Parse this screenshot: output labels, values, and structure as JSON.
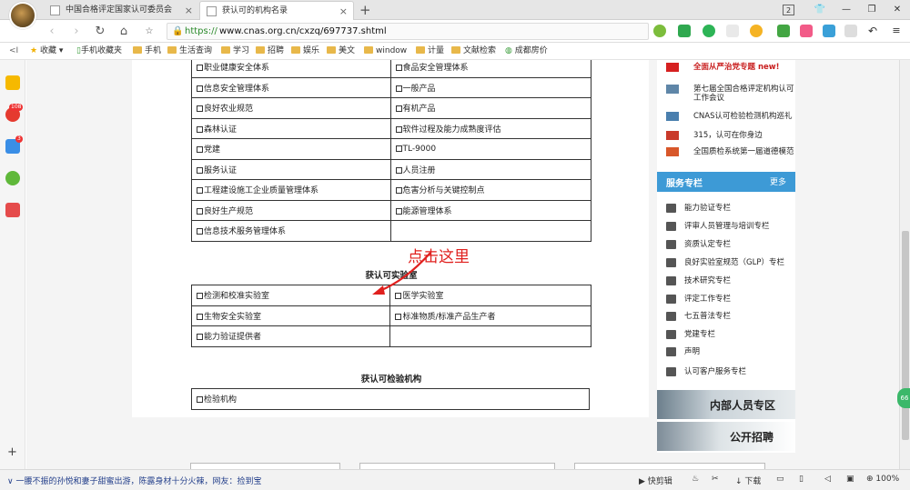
{
  "browser": {
    "tabs": [
      {
        "label": "中国合格评定国家认可委员会"
      },
      {
        "label": "获认可的机构名录"
      }
    ],
    "tab_count": "2",
    "url_protocol": "https://",
    "url_host": "www.cnas.org.cn/cxzq/697737.shtml",
    "bookmarks": [
      {
        "label": "收藏",
        "icon": "star-icon"
      },
      {
        "label": "手机收藏夹",
        "icon": "phone-icon"
      },
      {
        "label": "手机",
        "icon": "folder-icon"
      },
      {
        "label": "生活查询",
        "icon": "folder-icon"
      },
      {
        "label": "学习",
        "icon": "folder-icon"
      },
      {
        "label": "招聘",
        "icon": "folder-icon"
      },
      {
        "label": "娱乐",
        "icon": "folder-icon"
      },
      {
        "label": "美文",
        "icon": "folder-icon"
      },
      {
        "label": "window",
        "icon": "folder-icon"
      },
      {
        "label": "计量",
        "icon": "folder-icon"
      },
      {
        "label": "文献检索",
        "icon": "folder-icon"
      },
      {
        "label": "成都房价",
        "icon": "globe-icon"
      }
    ]
  },
  "left_sidebar": {
    "badges": [
      "108",
      "3"
    ]
  },
  "page": {
    "categories_table": [
      [
        "职业健康安全体系",
        "食品安全管理体系"
      ],
      [
        "信息安全管理体系",
        "一般产品"
      ],
      [
        "良好农业规范",
        "有机产品"
      ],
      [
        "森林认证",
        "软件过程及能力成熟度评估"
      ],
      [
        "党建",
        "TL-9000"
      ],
      [
        "服务认证",
        "人员注册"
      ],
      [
        "工程建设施工企业质量管理体系",
        "危害分析与关键控制点"
      ],
      [
        "良好生产规范",
        "能源管理体系"
      ],
      [
        "信息技术服务管理体系",
        ""
      ]
    ],
    "lab_section_title": "获认可实验室",
    "lab_table": [
      [
        "检测和校准实验室",
        "医学实验室"
      ],
      [
        "生物安全实验室",
        "标准物质/标准产品生产者"
      ],
      [
        "能力验证提供者",
        ""
      ]
    ],
    "inspection_section_title": "获认可检验机构",
    "inspection_table": [
      [
        "检验机构"
      ]
    ],
    "annotation": "点击这里"
  },
  "right_sidebar": {
    "news": [
      {
        "text": "全面从严治党专题 new!",
        "icon": "party-flag-icon"
      },
      {
        "text": "第七届全国合格评定机构认可工作会议",
        "icon": "photo-icon"
      },
      {
        "text": "CNAS认可检验检测机构巡礼",
        "icon": "photo-icon"
      },
      {
        "text": "315，认可在你身边",
        "icon": "poster-icon"
      },
      {
        "text": "全国质检系统第一届道德模范",
        "icon": "poster-icon"
      }
    ],
    "service_title": "服务专栏",
    "service_more": "更多",
    "service_items": [
      "能力验证专栏",
      "评审人员管理与培训专栏",
      "资质认定专栏",
      "良好实验室规范（GLP）专栏",
      "技术研究专栏",
      "评定工作专栏",
      "七五普法专栏",
      "党建专栏",
      "声明",
      "认可客户服务专栏"
    ],
    "banner_internal": "内部人员专区",
    "banner_jobs": "公开招聘",
    "float_badge": "66"
  },
  "statusbar": {
    "news": "一腰不振的孙悦和妻子甜蜜出游，陈露身材十分火辣，网友：捡到宝",
    "items": [
      "快剪辑",
      "下载",
      "100%"
    ]
  },
  "colors": {
    "accent_blue": "#3d9ad6",
    "annotation_red": "#e0201e",
    "url_green": "#2a8a2a"
  }
}
